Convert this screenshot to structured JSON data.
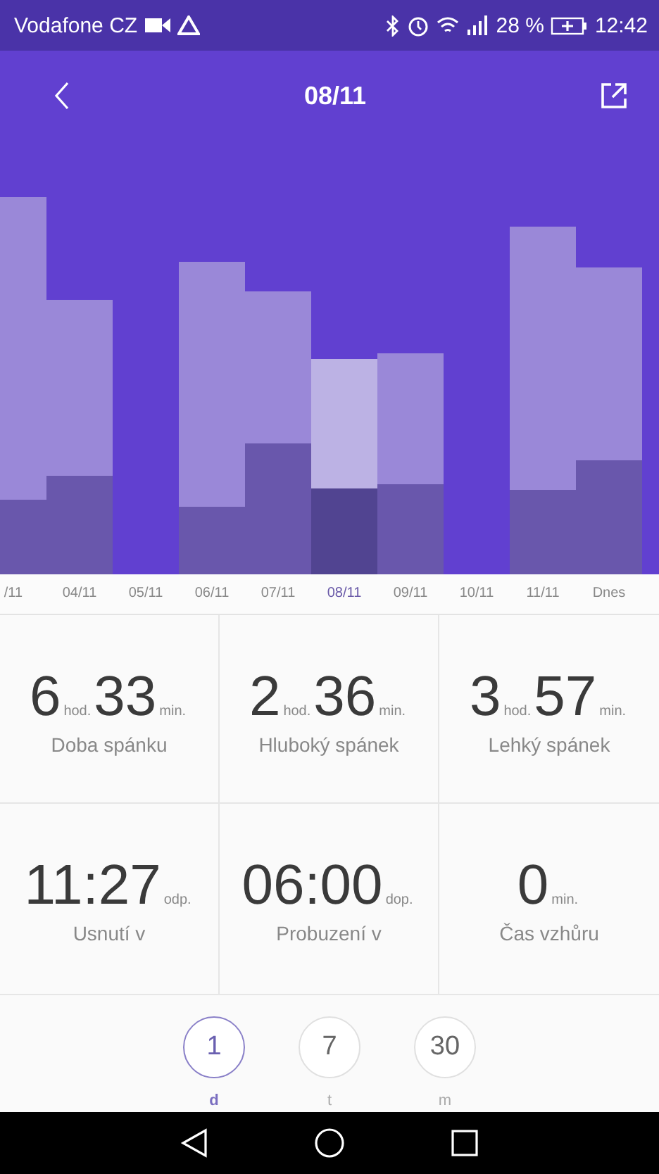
{
  "status_bar": {
    "carrier": "Vodafone CZ",
    "battery_percent": "28 %",
    "time": "12:42"
  },
  "header": {
    "title": "08/11"
  },
  "dates": [
    {
      "label": "/11",
      "selected": false
    },
    {
      "label": "04/11",
      "selected": false
    },
    {
      "label": "05/11",
      "selected": false
    },
    {
      "label": "06/11",
      "selected": false
    },
    {
      "label": "07/11",
      "selected": false
    },
    {
      "label": "08/11",
      "selected": true
    },
    {
      "label": "09/11",
      "selected": false
    },
    {
      "label": "10/11",
      "selected": false
    },
    {
      "label": "11/11",
      "selected": false
    },
    {
      "label": "Dnes",
      "selected": false
    }
  ],
  "stats": [
    {
      "kind": "duration",
      "hours": "6",
      "hours_unit": "hod.",
      "minutes": "33",
      "minutes_unit": "min.",
      "label": "Doba spánku"
    },
    {
      "kind": "duration",
      "hours": "2",
      "hours_unit": "hod.",
      "minutes": "36",
      "minutes_unit": "min.",
      "label": "Hluboký spánek"
    },
    {
      "kind": "duration",
      "hours": "3",
      "hours_unit": "hod.",
      "minutes": "57",
      "minutes_unit": "min.",
      "label": "Lehký spánek"
    },
    {
      "kind": "single",
      "value": "11:27",
      "unit": "odp.",
      "label": "Usnutí v"
    },
    {
      "kind": "single",
      "value": "06:00",
      "unit": "dop.",
      "label": "Probuzení v"
    },
    {
      "kind": "single",
      "value": "0",
      "unit": "min.",
      "label": "Čas vzhůru"
    }
  ],
  "periods": [
    {
      "value": "1",
      "label": "d",
      "selected": true
    },
    {
      "value": "7",
      "label": "t",
      "selected": false
    },
    {
      "value": "30",
      "label": "m",
      "selected": false
    }
  ]
}
